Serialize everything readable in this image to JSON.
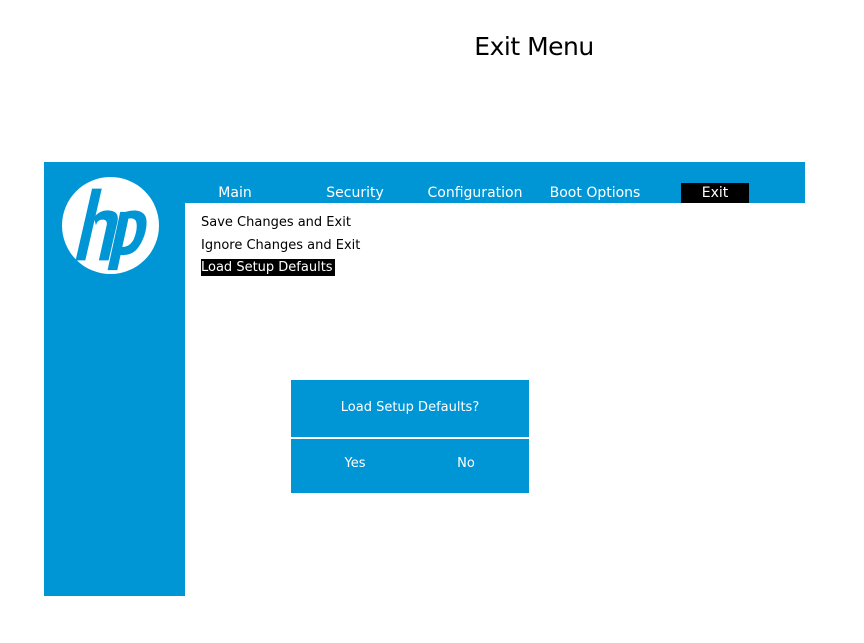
{
  "page_title": "Exit Menu",
  "logo": {
    "text": "hp",
    "icon": "hp-logo-icon",
    "color": "#0096d6"
  },
  "colors": {
    "brand_blue": "#0096d6",
    "active_tab_bg": "#000000",
    "selection_bg": "#000000",
    "text_light": "#ffffff"
  },
  "tabs": [
    {
      "label": "Main",
      "active": false
    },
    {
      "label": "Security",
      "active": false
    },
    {
      "label": "Configuration",
      "active": false
    },
    {
      "label": "Boot Options",
      "active": false
    },
    {
      "label": "Exit",
      "active": true
    }
  ],
  "menu": {
    "items": [
      {
        "label": "Save Changes and Exit",
        "selected": false
      },
      {
        "label": "Ignore Changes and Exit",
        "selected": false
      },
      {
        "label": "Load Setup Defaults",
        "selected": true
      }
    ]
  },
  "dialog": {
    "title": "Load Setup Defaults?",
    "yes_label": "Yes",
    "no_label": "No"
  }
}
